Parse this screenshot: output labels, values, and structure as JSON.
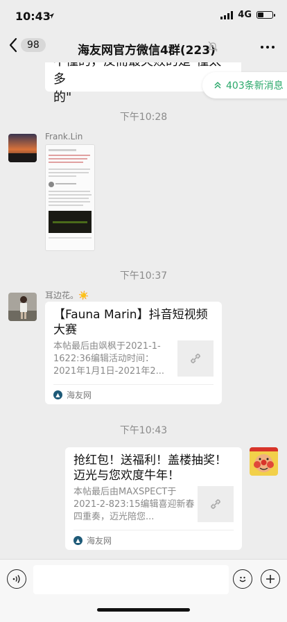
{
  "status_bar": {
    "time": "10:43",
    "network": "4G",
    "battery_level": 0.35
  },
  "nav": {
    "back_count": "98",
    "title": "海友网官方微信4群(223)"
  },
  "chat": {
    "partial_message": [
      "不懂的，反而最失败的是\"懂太多",
      "的\""
    ],
    "new_messages_label": "403条新消息",
    "timestamps": [
      "下午10:28",
      "下午10:37",
      "下午10:43"
    ],
    "messages": [
      {
        "sender": "Frank.Lin",
        "type": "image"
      },
      {
        "sender": "耳边花。☀️",
        "type": "link",
        "title": "【Fauna Marin】抖音短视频大赛",
        "desc": "本帖最后由飒枫于2021-1-1622:36编辑活动时间：2021年1月1日-2021年2...",
        "source": "海友网"
      },
      {
        "sender": "self",
        "type": "link",
        "title": "抢红包！送福利！盖楼抽奖！迈光与您欢度牛年！",
        "desc": "本帖最后由MAXSPECT于2021-2-823:15编辑喜迎新春四重奏，迈光陪您...",
        "source": "海友网"
      }
    ]
  },
  "colors": {
    "accent_green": "#2aa86a",
    "chat_bg": "#ededed",
    "bubble": "#ffffff"
  },
  "icons": {
    "back": "chevron-left-icon",
    "mute": "bell-off-icon",
    "more": "ellipsis-icon",
    "voice": "voice-icon",
    "emoji": "emoji-icon",
    "plus": "plus-icon",
    "link": "link-icon"
  }
}
